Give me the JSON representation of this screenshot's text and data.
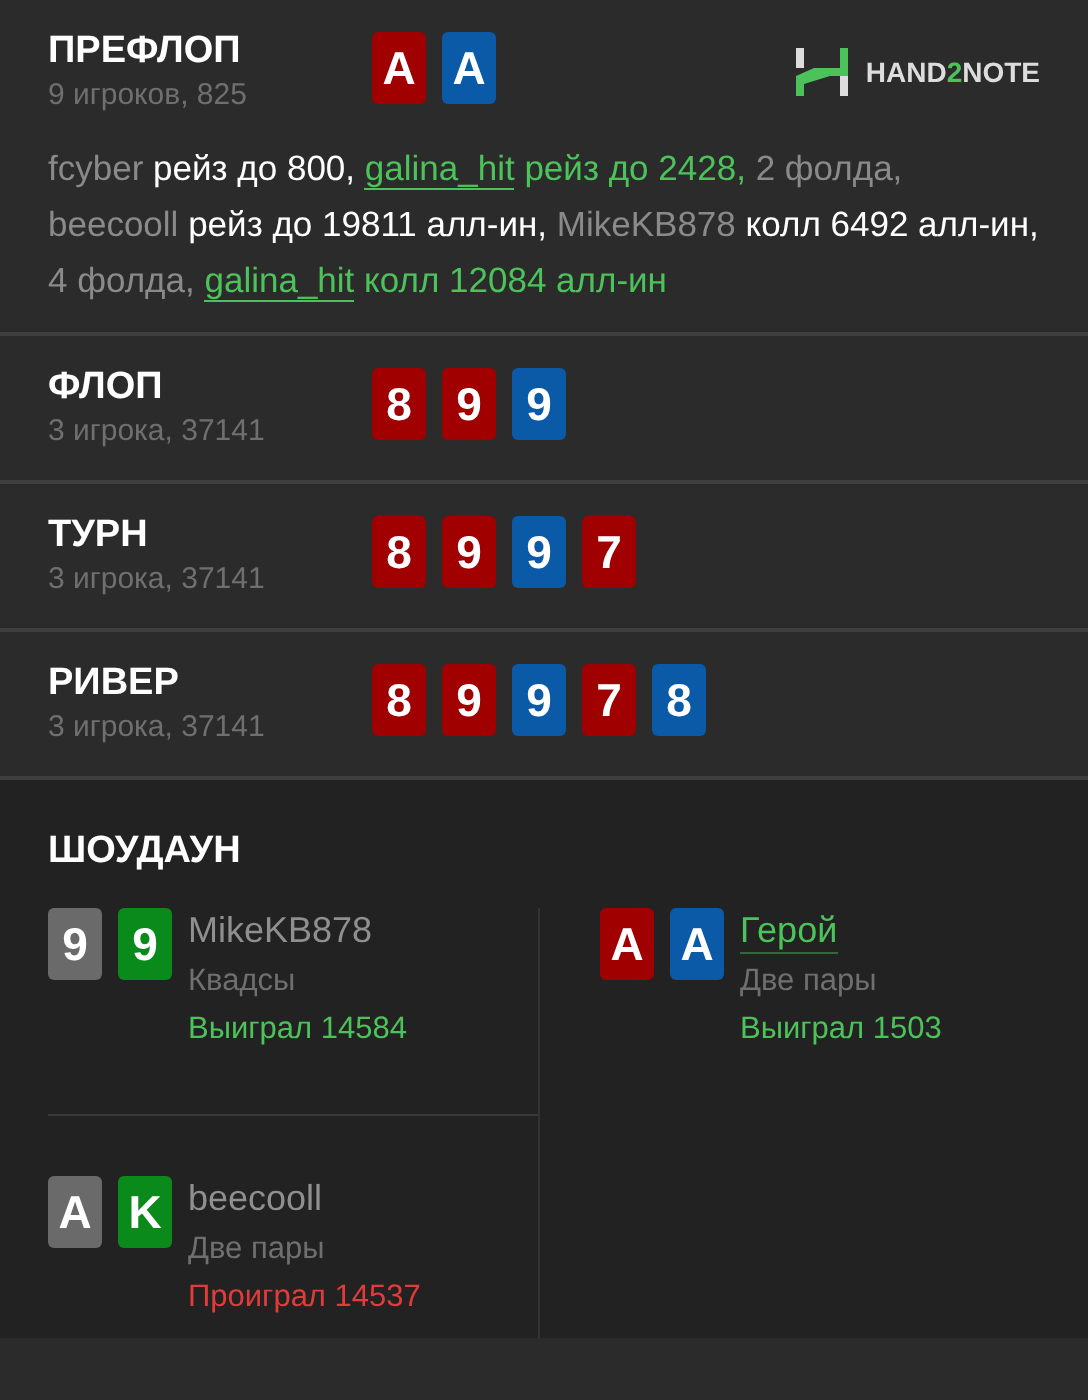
{
  "logo": {
    "text": "HAND",
    "accent": "2",
    "rest": "NOTE"
  },
  "preflop": {
    "title": "ПРЕФЛОП",
    "info": "9 игроков, 825",
    "cards": [
      {
        "rank": "A",
        "color": "#a00000"
      },
      {
        "rank": "A",
        "color": "#0b5aa8"
      }
    ],
    "actions": [
      {
        "kind": "player",
        "text": "fcyber"
      },
      {
        "kind": "action",
        "text": "рейз до 800,"
      },
      {
        "kind": "hero",
        "text": "galina_hit"
      },
      {
        "kind": "hero_action",
        "text": "рейз до 2428,"
      },
      {
        "kind": "muted",
        "text": "2 фолда,"
      },
      {
        "kind": "player",
        "text": "beecooll"
      },
      {
        "kind": "action",
        "text": "рейз до 19811 алл-ин,"
      },
      {
        "kind": "player",
        "text": "MikeKB878"
      },
      {
        "kind": "action",
        "text": "колл 6492 алл-ин,"
      },
      {
        "kind": "muted",
        "text": "4 фолда,"
      },
      {
        "kind": "hero",
        "text": "galina_hit"
      },
      {
        "kind": "hero_action",
        "text": "колл 12084 алл-ин"
      }
    ]
  },
  "streets": [
    {
      "title": "ФЛОП",
      "info": "3 игрока, 37141",
      "cards": [
        {
          "rank": "8",
          "color": "#a00000"
        },
        {
          "rank": "9",
          "color": "#a00000"
        },
        {
          "rank": "9",
          "color": "#0b5aa8"
        }
      ]
    },
    {
      "title": "ТУРН",
      "info": "3 игрока, 37141",
      "cards": [
        {
          "rank": "8",
          "color": "#a00000"
        },
        {
          "rank": "9",
          "color": "#a00000"
        },
        {
          "rank": "9",
          "color": "#0b5aa8"
        },
        {
          "rank": "7",
          "color": "#a00000"
        }
      ]
    },
    {
      "title": "РИВЕР",
      "info": "3 игрока, 37141",
      "cards": [
        {
          "rank": "8",
          "color": "#a00000"
        },
        {
          "rank": "9",
          "color": "#a00000"
        },
        {
          "rank": "9",
          "color": "#0b5aa8"
        },
        {
          "rank": "7",
          "color": "#a00000"
        },
        {
          "rank": "8",
          "color": "#0b5aa8"
        }
      ]
    }
  ],
  "showdown": {
    "title": "ШОУДАУН",
    "columns": [
      {
        "players": [
          {
            "name": "MikeKB878",
            "hero": false,
            "hand": "Квадсы",
            "result": "Выиграл 14584",
            "won": true,
            "cards": [
              {
                "rank": "9",
                "color": "#6a6a6a"
              },
              {
                "rank": "9",
                "color": "#0a8a1a"
              }
            ]
          },
          {
            "name": "beecooll",
            "hero": false,
            "hand": "Две пары",
            "result": "Проиграл 14537",
            "won": false,
            "cards": [
              {
                "rank": "A",
                "color": "#6a6a6a"
              },
              {
                "rank": "K",
                "color": "#0a8a1a"
              }
            ]
          }
        ]
      },
      {
        "players": [
          {
            "name": "Герой",
            "hero": true,
            "hand": "Две пары",
            "result": "Выиграл 1503",
            "won": true,
            "cards": [
              {
                "rank": "A",
                "color": "#a00000"
              },
              {
                "rank": "A",
                "color": "#0b5aa8"
              }
            ]
          }
        ]
      }
    ]
  }
}
